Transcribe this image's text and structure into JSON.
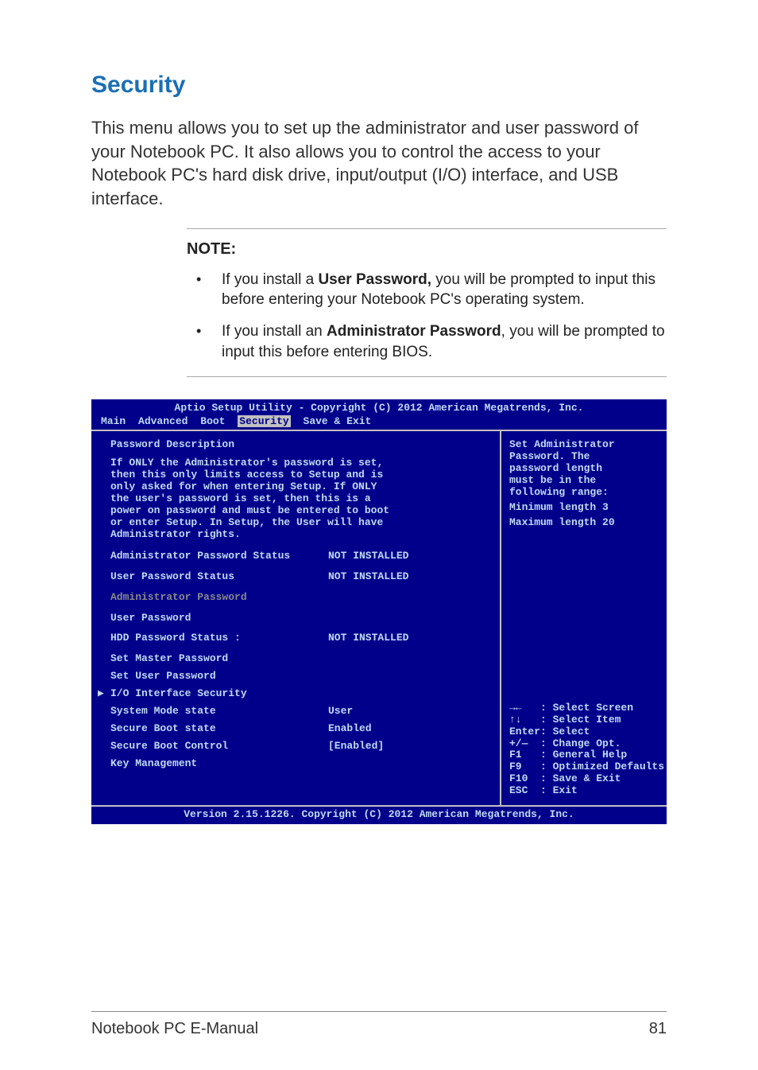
{
  "heading": "Security",
  "body_text": "This menu allows you to set up the administrator and user password of your Notebook PC. It also allows you to control the access to your Notebook PC's hard disk drive, input/output (I/O) interface, and USB interface.",
  "note": {
    "title": "NOTE:",
    "items": [
      {
        "before": "If you install a ",
        "bold": "User Password,",
        "after": " you will be prompted to input this before entering your Notebook PC's operating system."
      },
      {
        "before": "If you install an ",
        "bold": "Administrator Password",
        "after": ", you will be prompted to input this before entering BIOS."
      }
    ]
  },
  "bios": {
    "header": "Aptio Setup Utility - Copyright (C) 2012 American Megatrends, Inc.",
    "tabs": {
      "main": "Main",
      "advanced": "Advanced",
      "boot": "Boot",
      "security": "Security",
      "save": "Save & Exit"
    },
    "desc_title": "Password Description",
    "desc_body": "If ONLY the Administrator's password is set,\nthen this only limits access to Setup and is\nonly asked for when entering Setup. If ONLY\nthe user's password is set, then this is a\npower on password and must be entered to boot\nor enter Setup. In Setup, the User will have\nAdministrator rights.",
    "rows": {
      "admin_status_label": "Administrator Password Status",
      "admin_status_value": "NOT INSTALLED",
      "user_status_label": "User Password Status",
      "user_status_value": "NOT INSTALLED",
      "admin_pw": "Administrator Password",
      "user_pw": "User Password",
      "hdd_label": "HDD Password Status :",
      "hdd_value": "NOT INSTALLED",
      "set_master": "Set Master Password",
      "set_user": "Set User Password",
      "io_sec": "I/O Interface Security",
      "sysmode_label": "System Mode state",
      "sysmode_value": "User",
      "secureboot_state_label": "Secure Boot state",
      "secureboot_state_value": "Enabled",
      "secureboot_ctrl_label": "Secure Boot Control",
      "secureboot_ctrl_value": "[Enabled]",
      "keymgmt": "Key Management"
    },
    "help": {
      "l1": "Set Administrator",
      "l2": "Password. The",
      "l3": "password length",
      "l4": "must be in the",
      "l5": "following range:",
      "l6": "Minimum length 3",
      "l7": "Maximum length 20"
    },
    "keys": {
      "k1": "→←   : Select Screen",
      "k2": "↑↓   : Select Item",
      "k3": "Enter: Select",
      "k4": "+/—  : Change Opt.",
      "k5": "F1   : General Help",
      "k6": "F9   : Optimized Defaults",
      "k7": "F10  : Save & Exit",
      "k8": "ESC  : Exit"
    },
    "footer": "Version 2.15.1226. Copyright (C) 2012 American Megatrends, Inc."
  },
  "page": {
    "left": "Notebook PC E-Manual",
    "right": "81"
  }
}
